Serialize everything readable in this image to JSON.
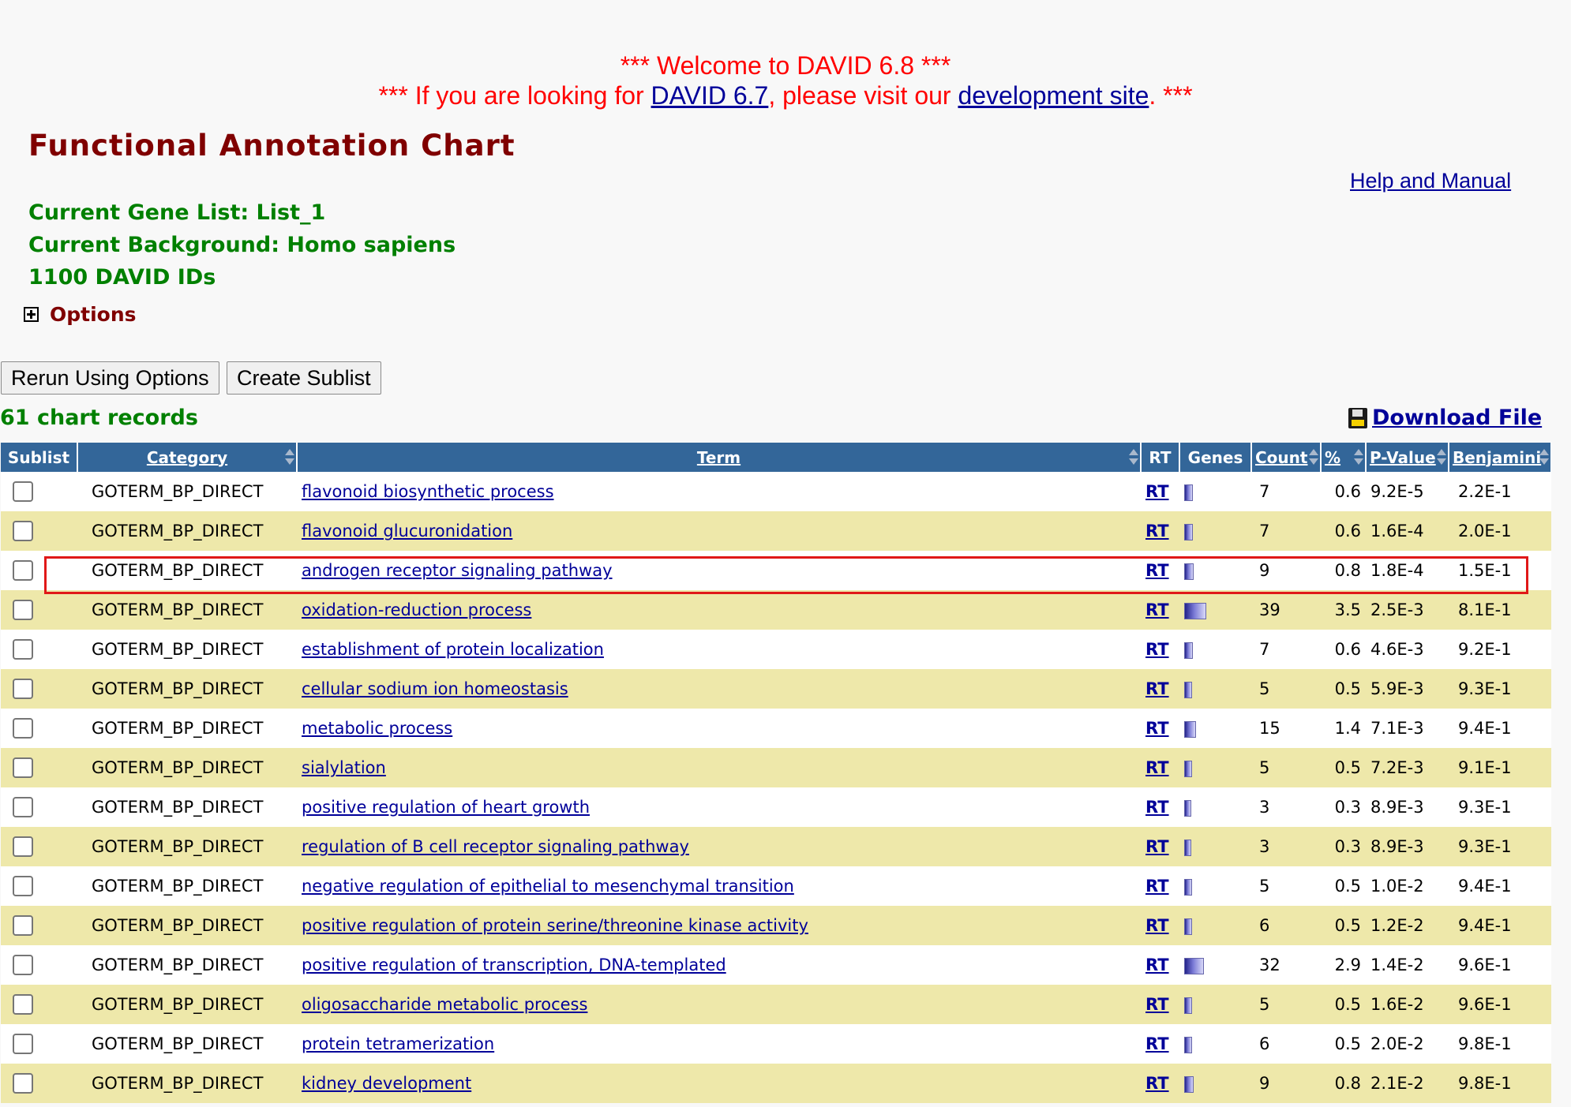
{
  "banner": {
    "line1": "*** Welcome to DAVID 6.8 ***",
    "line2_prefix": "*** If you are looking for ",
    "line2_link1": "DAVID 6.7",
    "line2_middle": ", please visit our ",
    "line2_link2": "development site",
    "line2_suffix": ". ***"
  },
  "page_title": "Functional Annotation Chart",
  "help_link": "Help and Manual",
  "info": {
    "gene_list": "Current Gene List: List_1",
    "background": "Current Background: Homo sapiens",
    "ids": "1100 DAVID IDs"
  },
  "options_label": "Options",
  "buttons": {
    "rerun": "Rerun Using Options",
    "sublist": "Create Sublist"
  },
  "records_label": "61 chart records",
  "download_label": "Download File",
  "table": {
    "headers": {
      "sublist": "Sublist",
      "category": "Category",
      "term": "Term",
      "rt": "RT",
      "genes": "Genes",
      "count": "Count",
      "percent": "%",
      "pvalue": "P-Value",
      "benjamini": "Benjamini"
    },
    "rows": [
      {
        "category": "GOTERM_BP_DIRECT",
        "term": "flavonoid biosynthetic process",
        "rt": "RT",
        "count": "7",
        "percent": "0.6",
        "pvalue": "9.2E-5",
        "benjamini": "2.2E-1"
      },
      {
        "category": "GOTERM_BP_DIRECT",
        "term": "flavonoid glucuronidation",
        "rt": "RT",
        "count": "7",
        "percent": "0.6",
        "pvalue": "1.6E-4",
        "benjamini": "2.0E-1"
      },
      {
        "category": "GOTERM_BP_DIRECT",
        "term": "androgen receptor signaling pathway",
        "rt": "RT",
        "count": "9",
        "percent": "0.8",
        "pvalue": "1.8E-4",
        "benjamini": "1.5E-1"
      },
      {
        "category": "GOTERM_BP_DIRECT",
        "term": "oxidation-reduction process",
        "rt": "RT",
        "count": "39",
        "percent": "3.5",
        "pvalue": "2.5E-3",
        "benjamini": "8.1E-1"
      },
      {
        "category": "GOTERM_BP_DIRECT",
        "term": "establishment of protein localization",
        "rt": "RT",
        "count": "7",
        "percent": "0.6",
        "pvalue": "4.6E-3",
        "benjamini": "9.2E-1"
      },
      {
        "category": "GOTERM_BP_DIRECT",
        "term": "cellular sodium ion homeostasis",
        "rt": "RT",
        "count": "5",
        "percent": "0.5",
        "pvalue": "5.9E-3",
        "benjamini": "9.3E-1"
      },
      {
        "category": "GOTERM_BP_DIRECT",
        "term": "metabolic process",
        "rt": "RT",
        "count": "15",
        "percent": "1.4",
        "pvalue": "7.1E-3",
        "benjamini": "9.4E-1"
      },
      {
        "category": "GOTERM_BP_DIRECT",
        "term": "sialylation",
        "rt": "RT",
        "count": "5",
        "percent": "0.5",
        "pvalue": "7.2E-3",
        "benjamini": "9.1E-1"
      },
      {
        "category": "GOTERM_BP_DIRECT",
        "term": "positive regulation of heart growth",
        "rt": "RT",
        "count": "3",
        "percent": "0.3",
        "pvalue": "8.9E-3",
        "benjamini": "9.3E-1"
      },
      {
        "category": "GOTERM_BP_DIRECT",
        "term": "regulation of B cell receptor signaling pathway",
        "rt": "RT",
        "count": "3",
        "percent": "0.3",
        "pvalue": "8.9E-3",
        "benjamini": "9.3E-1"
      },
      {
        "category": "GOTERM_BP_DIRECT",
        "term": "negative regulation of epithelial to mesenchymal transition",
        "rt": "RT",
        "count": "5",
        "percent": "0.5",
        "pvalue": "1.0E-2",
        "benjamini": "9.4E-1"
      },
      {
        "category": "GOTERM_BP_DIRECT",
        "term": "positive regulation of protein serine/threonine kinase activity",
        "rt": "RT",
        "count": "6",
        "percent": "0.5",
        "pvalue": "1.2E-2",
        "benjamini": "9.4E-1"
      },
      {
        "category": "GOTERM_BP_DIRECT",
        "term": "positive regulation of transcription, DNA-templated",
        "rt": "RT",
        "count": "32",
        "percent": "2.9",
        "pvalue": "1.4E-2",
        "benjamini": "9.6E-1"
      },
      {
        "category": "GOTERM_BP_DIRECT",
        "term": "oligosaccharide metabolic process",
        "rt": "RT",
        "count": "5",
        "percent": "0.5",
        "pvalue": "1.6E-2",
        "benjamini": "9.6E-1"
      },
      {
        "category": "GOTERM_BP_DIRECT",
        "term": "protein tetramerization",
        "rt": "RT",
        "count": "6",
        "percent": "0.5",
        "pvalue": "2.0E-2",
        "benjamini": "9.8E-1"
      },
      {
        "category": "GOTERM_BP_DIRECT",
        "term": "kidney development",
        "rt": "RT",
        "count": "9",
        "percent": "0.8",
        "pvalue": "2.1E-2",
        "benjamini": "9.8E-1"
      }
    ]
  },
  "colors": {
    "header_bg": "#336699",
    "row_alt": "#eee8aa",
    "title": "#800000",
    "info": "#008000",
    "link": "#000099",
    "banner": "#ff0000",
    "highlight": "#e01818"
  }
}
